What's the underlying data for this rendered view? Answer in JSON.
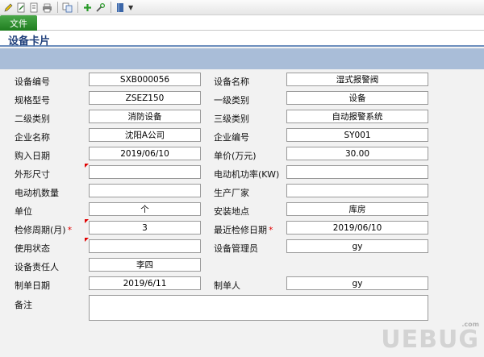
{
  "menu": {
    "file_label": "文件"
  },
  "header": {
    "title": "设备卡片"
  },
  "toolbar": {
    "icons": [
      "pencil-icon",
      "document-icon",
      "print-icon",
      "copy-icon",
      "add-icon",
      "tools-icon",
      "book-icon"
    ]
  },
  "form": {
    "device_no": {
      "label": "设备编号",
      "value": "SXB000056"
    },
    "device_name": {
      "label": "设备名称",
      "value": "湿式报警阀"
    },
    "model": {
      "label": "规格型号",
      "value": "ZSEZ150"
    },
    "category1": {
      "label": "一级类别",
      "value": "设备"
    },
    "category2": {
      "label": "二级类别",
      "value": "消防设备"
    },
    "category3": {
      "label": "三级类别",
      "value": "自动报警系统"
    },
    "company_name": {
      "label": "企业名称",
      "value": "沈阳A公司"
    },
    "company_no": {
      "label": "企业编号",
      "value": "SY001"
    },
    "purchase_date": {
      "label": "购入日期",
      "value": "2019/06/10"
    },
    "unit_price": {
      "label": "单价(万元)",
      "value": "30.00"
    },
    "dimensions": {
      "label": "外形尺寸",
      "value": ""
    },
    "motor_power": {
      "label": "电动机功率(KW)",
      "value": ""
    },
    "motor_count": {
      "label": "电动机数量",
      "value": ""
    },
    "manufacturer": {
      "label": "生产厂家",
      "value": ""
    },
    "unit": {
      "label": "单位",
      "value": "个"
    },
    "install_site": {
      "label": "安装地点",
      "value": "库房"
    },
    "inspect_cycle": {
      "label": "检修周期(月)",
      "value": "3",
      "required_mark": "*"
    },
    "last_inspect": {
      "label": "最近检修日期",
      "value": "2019/06/10",
      "required_mark": "*"
    },
    "usage_status": {
      "label": "使用状态",
      "value": ""
    },
    "device_manager": {
      "label": "设备管理员",
      "value": "gy"
    },
    "responsible": {
      "label": "设备责任人",
      "value": "李四"
    },
    "created_date": {
      "label": "制单日期",
      "value": "2019/6/11"
    },
    "creator": {
      "label": "制单人",
      "value": "gy"
    },
    "remarks": {
      "label": "备注",
      "value": ""
    }
  },
  "watermark": {
    "text": "UEBUG",
    "sub": ".com"
  },
  "colors": {
    "file_menu": "#2e8b2e",
    "title": "#1f3f7a",
    "strip": "#a9bdd8",
    "required": "#e00000"
  }
}
